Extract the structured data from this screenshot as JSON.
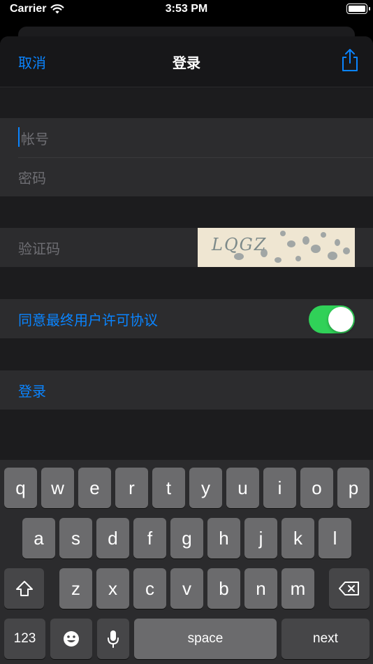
{
  "status": {
    "carrier": "Carrier",
    "time": "3:53 PM"
  },
  "nav": {
    "cancel": "取消",
    "title": "登录"
  },
  "form": {
    "account_placeholder": "帐号",
    "password_placeholder": "密码",
    "captcha_placeholder": "验证码",
    "captcha_code": "LQGZ",
    "agree_label": "同意最终用户许可协议",
    "agree_on": true,
    "login_label": "登录"
  },
  "keyboard": {
    "row1": [
      "q",
      "w",
      "e",
      "r",
      "t",
      "y",
      "u",
      "i",
      "o",
      "p"
    ],
    "row2": [
      "a",
      "s",
      "d",
      "f",
      "g",
      "h",
      "j",
      "k",
      "l"
    ],
    "row3": [
      "z",
      "x",
      "c",
      "v",
      "b",
      "n",
      "m"
    ],
    "numbers_key": "123",
    "space_key": "space",
    "next_key": "next"
  },
  "colors": {
    "accent": "#0a84ff",
    "toggle_on": "#30d158",
    "background": "#1c1c1e",
    "cell": "#2c2c2e"
  },
  "icons": {
    "share": "share-icon",
    "wifi": "wifi-icon",
    "shift": "shift-icon",
    "delete": "delete-icon",
    "emoji": "emoji-icon",
    "mic": "microphone-icon"
  }
}
